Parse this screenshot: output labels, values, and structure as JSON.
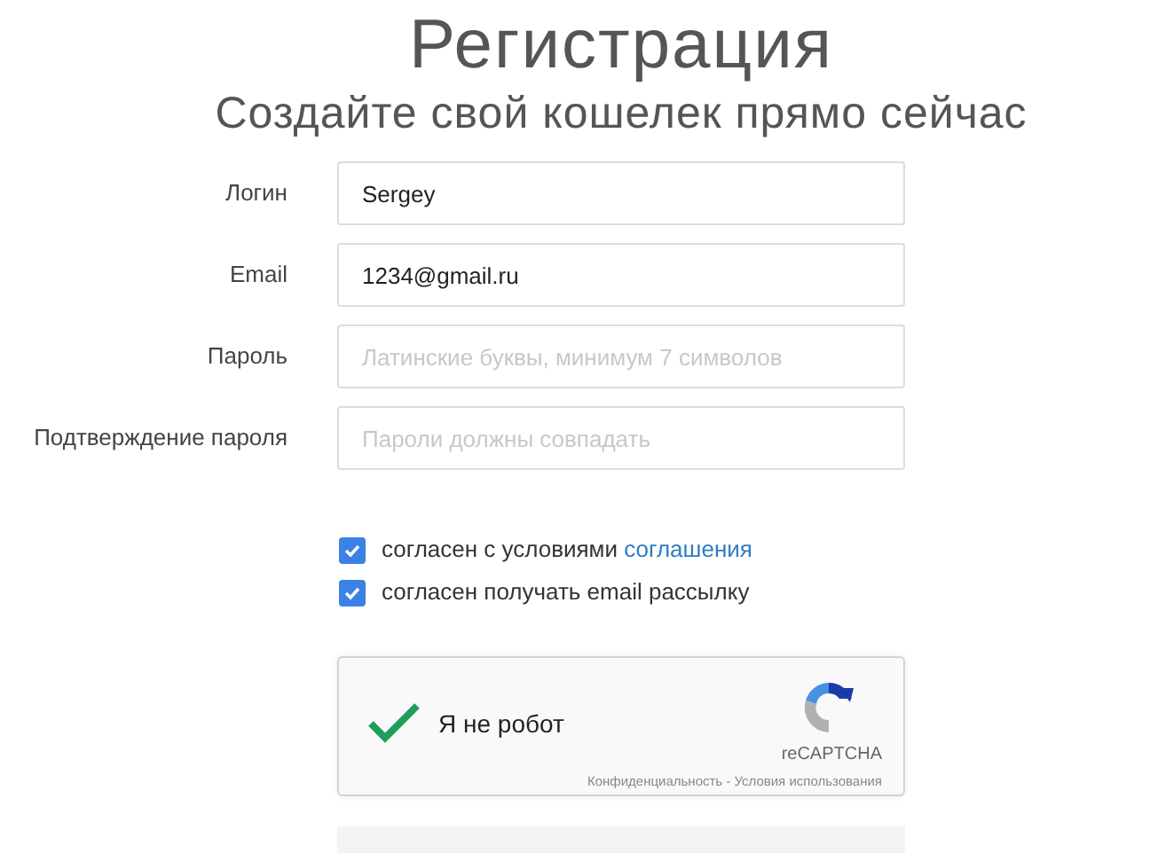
{
  "title": "Регистрация",
  "subtitle": "Создайте свой кошелек прямо сейчас",
  "fields": [
    {
      "label": "Логин",
      "value": "Sergey"
    },
    {
      "label": "Email",
      "value": "1234@gmail.ru"
    },
    {
      "label": "Пароль",
      "placeholder": "Латинские буквы, минимум 7 символов"
    },
    {
      "label": "Подтверждение пароля",
      "placeholder": "Пароли должны совпадать"
    }
  ],
  "checkboxes": [
    {
      "text": "согласен с условиями",
      "link": "соглашения",
      "checked": true
    },
    {
      "text": "согласен получать email рассылку",
      "checked": true
    }
  ],
  "captcha": {
    "label": "Я не робот",
    "checked": true,
    "brand": "reCAPTCHA",
    "footer": "Конфиденциальность - Условия использования"
  }
}
